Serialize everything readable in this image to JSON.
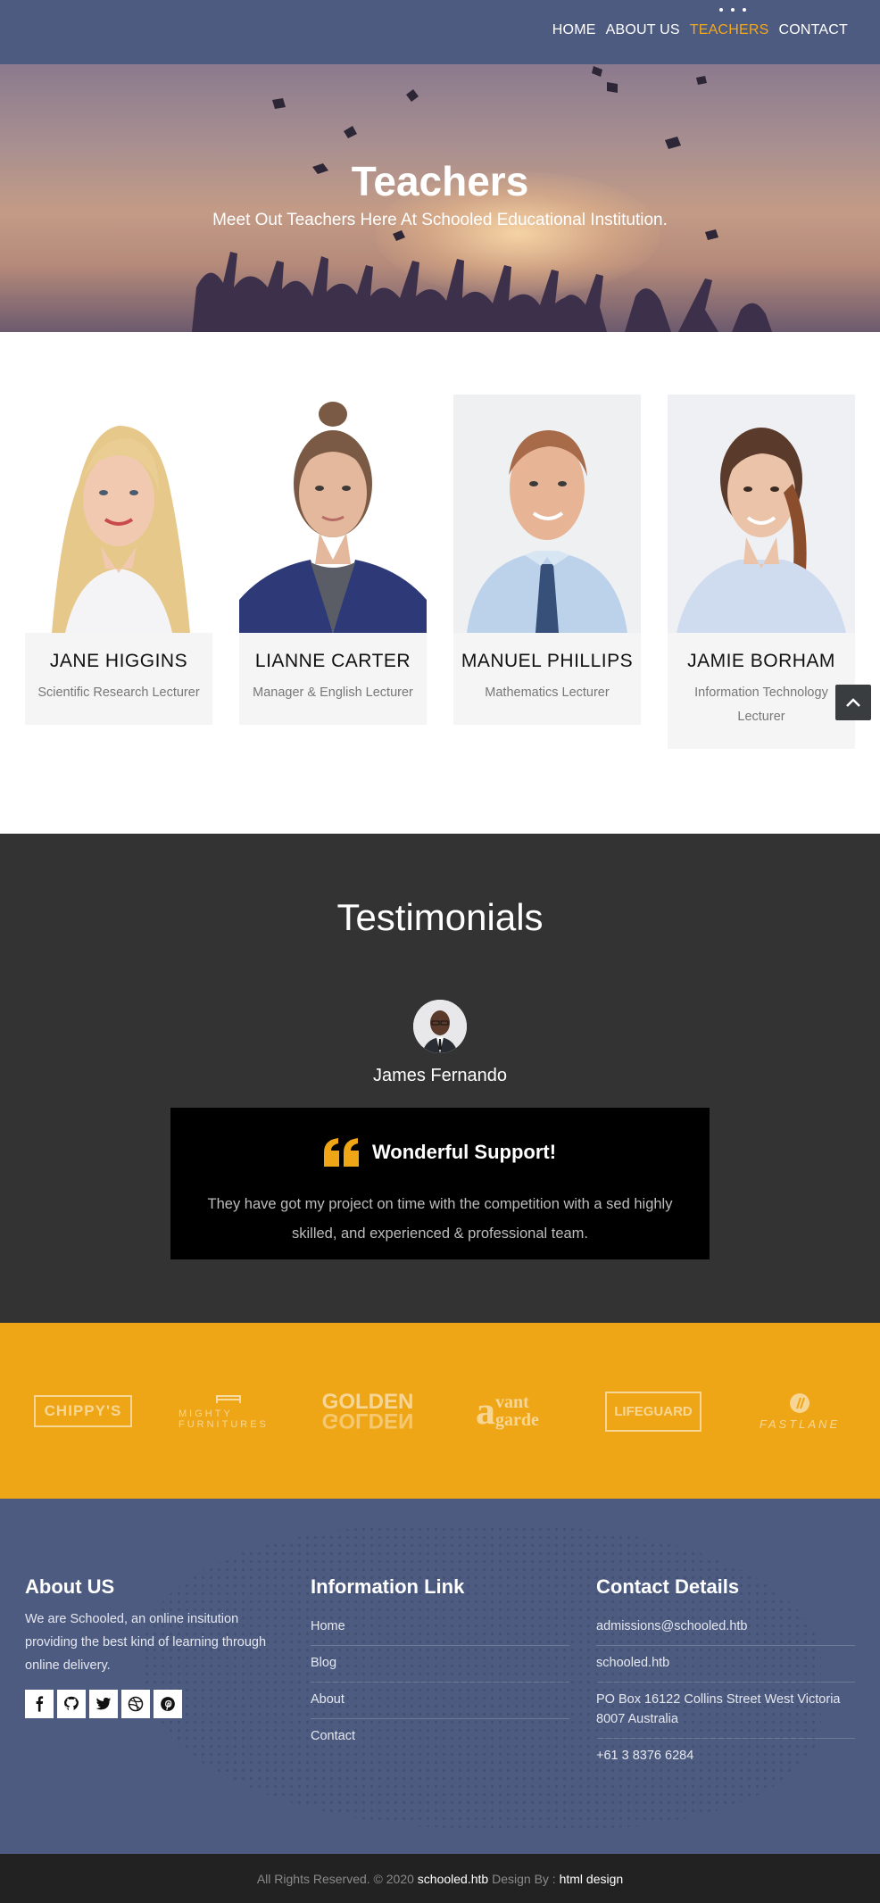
{
  "nav": {
    "items": [
      {
        "label": "HOME",
        "active": false
      },
      {
        "label": "ABOUT US",
        "active": false
      },
      {
        "label": "TEACHERS",
        "active": true
      },
      {
        "label": "CONTACT",
        "active": false
      }
    ],
    "active_color": "#f2a81d"
  },
  "hero": {
    "title": "Teachers",
    "subtitle": "Meet Out Teachers Here At Schooled Educational Institution."
  },
  "teachers": [
    {
      "name": "JANE HIGGINS",
      "role": "Scientific Research Lecturer"
    },
    {
      "name": "LIANNE CARTER",
      "role": "Manager & English Lecturer"
    },
    {
      "name": "MANUEL PHILLIPS",
      "role": "Mathematics Lecturer"
    },
    {
      "name": "JAMIE BORHAM",
      "role": "Information Technology Lecturer"
    }
  ],
  "testimonials": {
    "title": "Testimonials",
    "person": "James Fernando",
    "quote_title": "Wonderful Support!",
    "quote_text": "They have got my project on time with the competition with a sed highly skilled, and experienced & professional team."
  },
  "partners": {
    "logos": [
      "CHIPPY'S",
      "MIGHTY FURNITURES",
      "GOLDEN",
      "vant garde",
      "LIFEGUARD",
      "FASTLANE"
    ],
    "background": "#eea516"
  },
  "footer": {
    "about": {
      "title": "About US",
      "text": "We are Schooled, an online insitution providing the best kind of learning through online delivery.",
      "socials": [
        "facebook-icon",
        "github-icon",
        "twitter-icon",
        "dribbble-icon",
        "pinterest-icon"
      ]
    },
    "links": {
      "title": "Information Link",
      "items": [
        "Home",
        "Blog",
        "About",
        "Contact"
      ]
    },
    "contact": {
      "title": "Contact Details",
      "items": [
        "admissions@schooled.htb",
        "schooled.htb",
        "PO Box 16122 Collins Street West Victoria 8007 Australia",
        "+61 3 8376 6284"
      ]
    }
  },
  "copyright": {
    "prefix": "All Rights Reserved. © 2020",
    "site": "schooled.htb",
    "design_by": "Design By :",
    "designer": "html design"
  }
}
